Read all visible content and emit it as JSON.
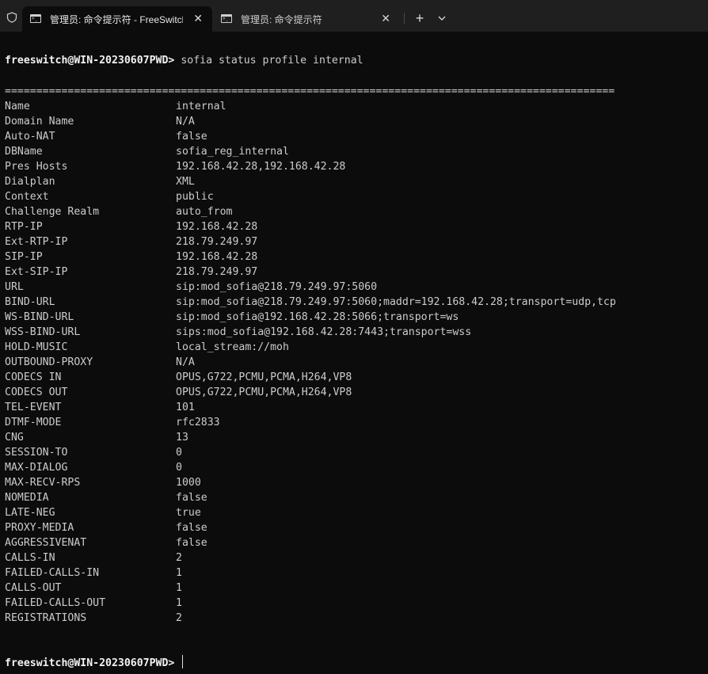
{
  "tabs": [
    {
      "title": "管理员: 命令提示符 - FreeSwitch",
      "active": true
    },
    {
      "title": "管理员: 命令提示符",
      "active": false
    }
  ],
  "tab_controls": {
    "close": "✕",
    "new_tab": "+"
  },
  "terminal": {
    "prompt": "freeswitch@WIN-20230607PWD>",
    "command": "sofia status profile internal",
    "rule": "=================================================================================================",
    "rows": [
      {
        "key": "Name",
        "value": "internal"
      },
      {
        "key": "Domain Name",
        "value": "N/A"
      },
      {
        "key": "Auto-NAT",
        "value": "false"
      },
      {
        "key": "DBName",
        "value": "sofia_reg_internal"
      },
      {
        "key": "Pres Hosts",
        "value": "192.168.42.28,192.168.42.28"
      },
      {
        "key": "Dialplan",
        "value": "XML"
      },
      {
        "key": "Context",
        "value": "public"
      },
      {
        "key": "Challenge Realm",
        "value": "auto_from"
      },
      {
        "key": "RTP-IP",
        "value": "192.168.42.28"
      },
      {
        "key": "Ext-RTP-IP",
        "value": "218.79.249.97"
      },
      {
        "key": "SIP-IP",
        "value": "192.168.42.28"
      },
      {
        "key": "Ext-SIP-IP",
        "value": "218.79.249.97"
      },
      {
        "key": "URL",
        "value": "sip:mod_sofia@218.79.249.97:5060"
      },
      {
        "key": "BIND-URL",
        "value": "sip:mod_sofia@218.79.249.97:5060;maddr=192.168.42.28;transport=udp,tcp"
      },
      {
        "key": "WS-BIND-URL",
        "value": "sip:mod_sofia@192.168.42.28:5066;transport=ws"
      },
      {
        "key": "WSS-BIND-URL",
        "value": "sips:mod_sofia@192.168.42.28:7443;transport=wss"
      },
      {
        "key": "HOLD-MUSIC",
        "value": "local_stream://moh"
      },
      {
        "key": "OUTBOUND-PROXY",
        "value": "N/A"
      },
      {
        "key": "CODECS IN",
        "value": "OPUS,G722,PCMU,PCMA,H264,VP8"
      },
      {
        "key": "CODECS OUT",
        "value": "OPUS,G722,PCMU,PCMA,H264,VP8"
      },
      {
        "key": "TEL-EVENT",
        "value": "101"
      },
      {
        "key": "DTMF-MODE",
        "value": "rfc2833"
      },
      {
        "key": "CNG",
        "value": "13"
      },
      {
        "key": "SESSION-TO",
        "value": "0"
      },
      {
        "key": "MAX-DIALOG",
        "value": "0"
      },
      {
        "key": "MAX-RECV-RPS",
        "value": "1000"
      },
      {
        "key": "NOMEDIA",
        "value": "false"
      },
      {
        "key": "LATE-NEG",
        "value": "true"
      },
      {
        "key": "PROXY-MEDIA",
        "value": "false"
      },
      {
        "key": "AGGRESSIVENAT",
        "value": "false"
      },
      {
        "key": "CALLS-IN",
        "value": "2"
      },
      {
        "key": "FAILED-CALLS-IN",
        "value": "1"
      },
      {
        "key": "CALLS-OUT",
        "value": "1"
      },
      {
        "key": "FAILED-CALLS-OUT",
        "value": "1"
      },
      {
        "key": "REGISTRATIONS",
        "value": "2"
      }
    ]
  },
  "colors": {
    "background": "#0c0c0c",
    "text": "#cccccc",
    "tabbar": "#1f1f1f"
  },
  "icons": {
    "shield": "shield-icon",
    "terminal": "terminal-icon",
    "dropdown": "chevron-down-icon"
  }
}
